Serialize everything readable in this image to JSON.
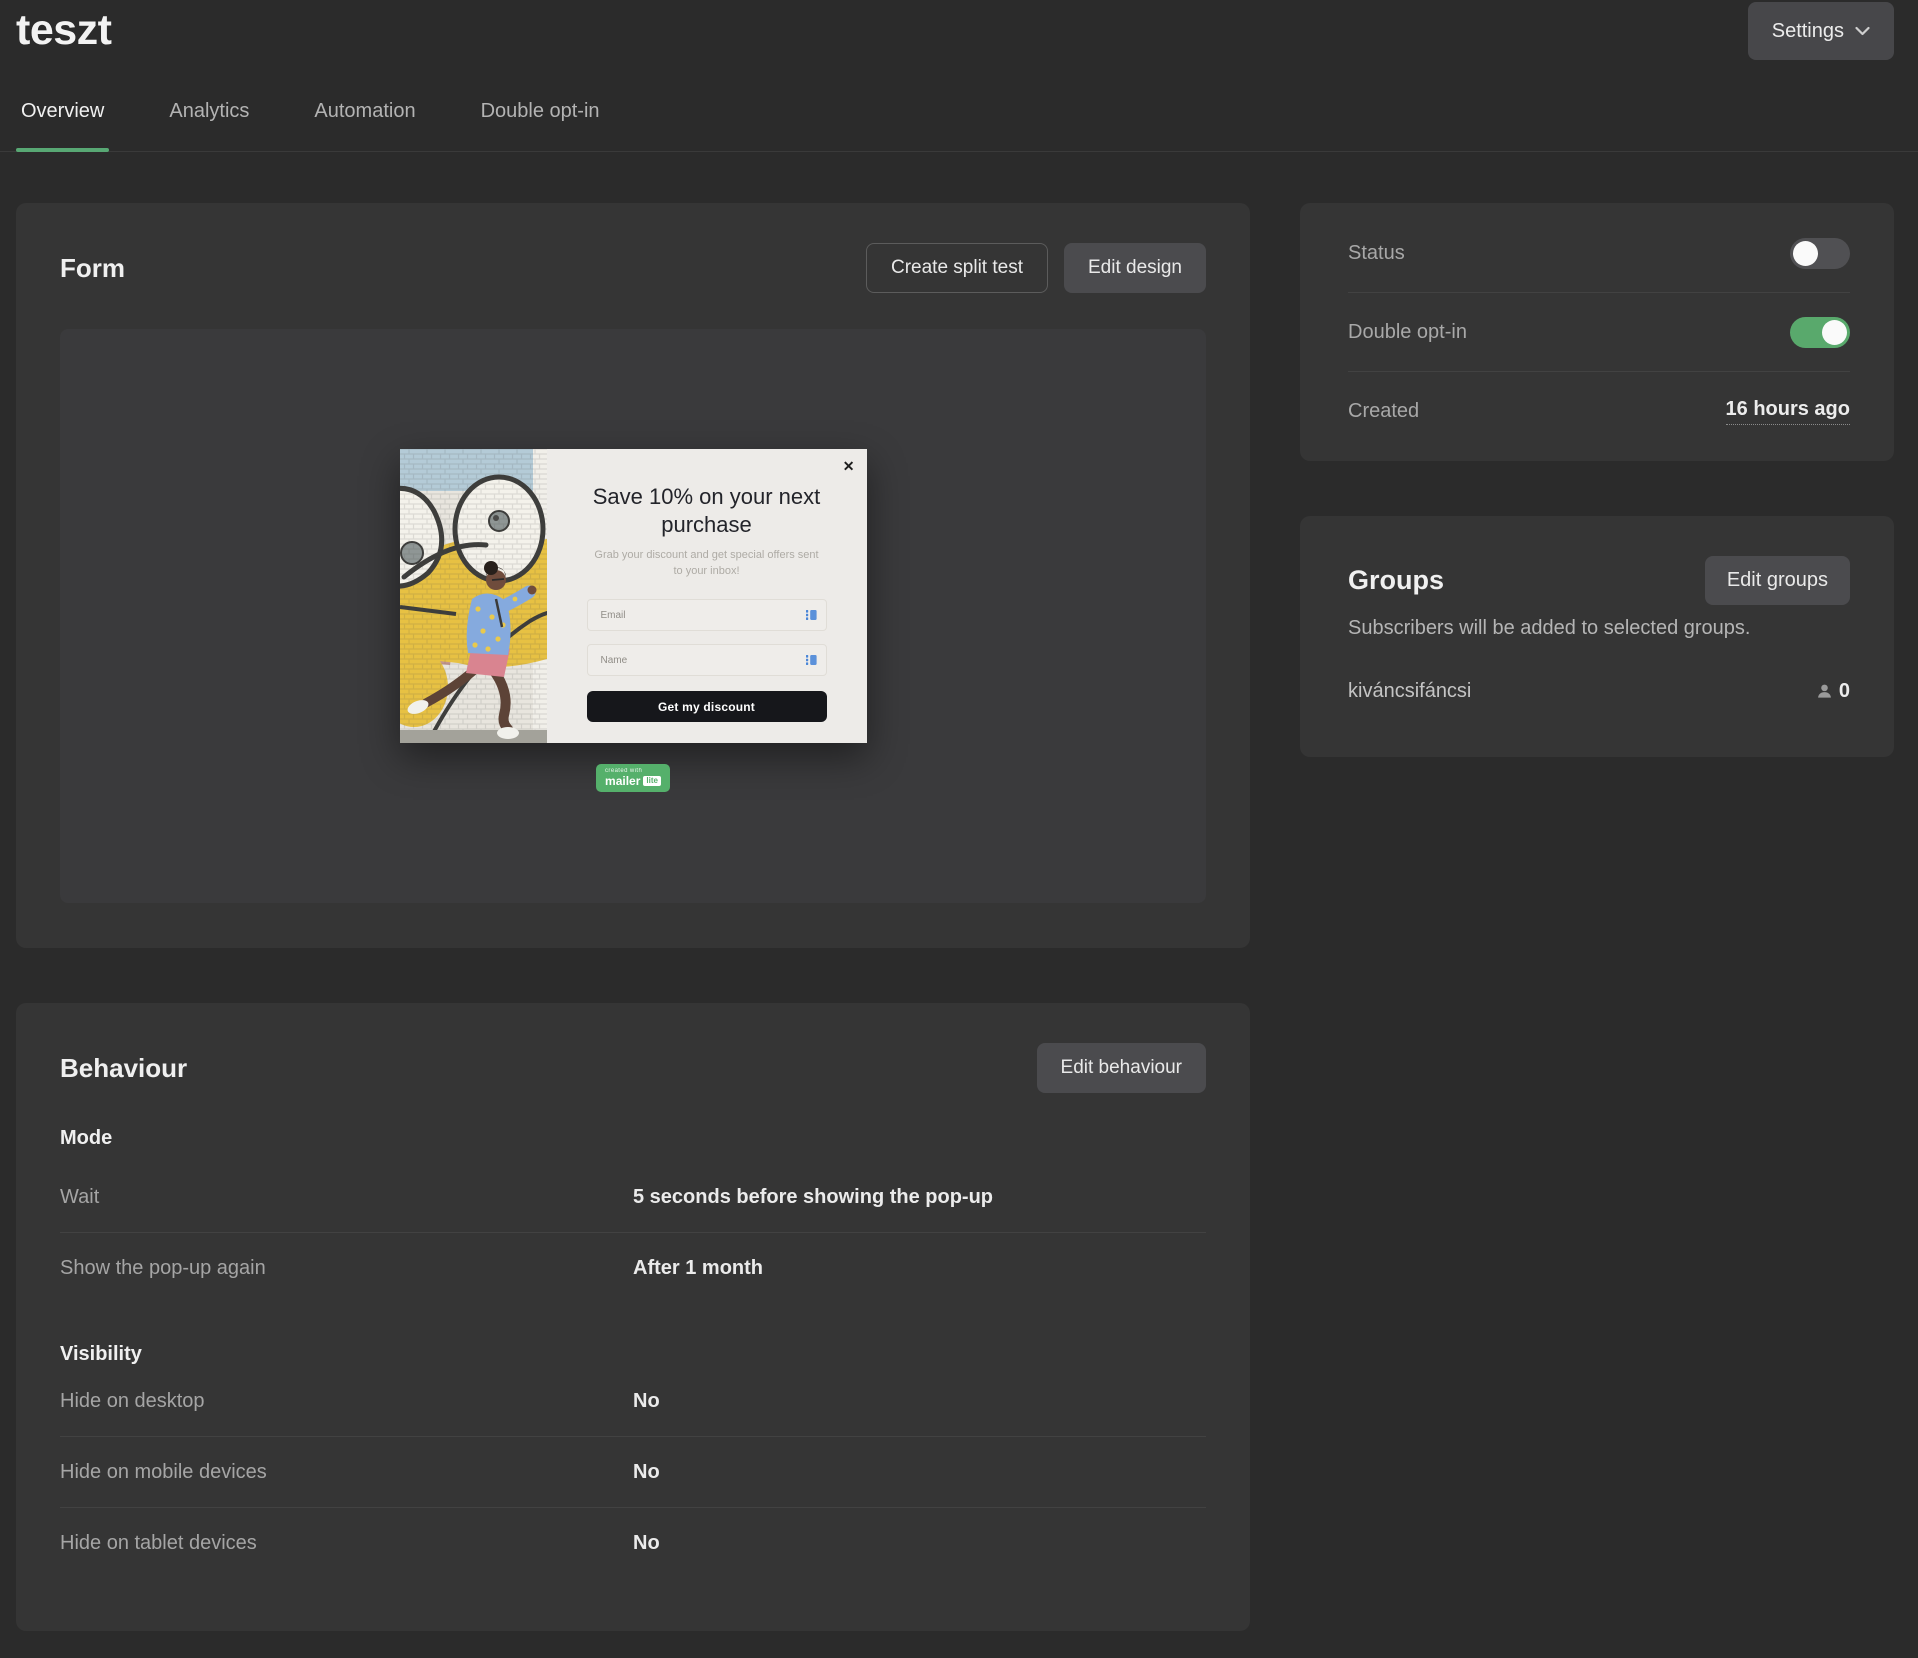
{
  "header": {
    "title": "teszt",
    "settings_label": "Settings"
  },
  "tabs": [
    {
      "label": "Overview",
      "active": true
    },
    {
      "label": "Analytics",
      "active": false
    },
    {
      "label": "Automation",
      "active": false
    },
    {
      "label": "Double opt-in",
      "active": false
    }
  ],
  "form_card": {
    "title": "Form",
    "buttons": {
      "create_split_test": "Create split test",
      "edit_design": "Edit design"
    },
    "popup": {
      "heading": "Save 10% on your next purchase",
      "subheading": "Grab your discount and get special offers sent to your inbox!",
      "email_placeholder": "Email",
      "name_placeholder": "Name",
      "submit_label": "Get my discount"
    },
    "badge": {
      "line1": "created with",
      "brand": "mailer",
      "suffix": "lite"
    }
  },
  "status_card": {
    "rows": [
      {
        "label": "Status",
        "toggle_state": "off"
      },
      {
        "label": "Double opt-in",
        "toggle_state": "on"
      },
      {
        "label": "Created",
        "value": "16 hours ago"
      }
    ]
  },
  "groups_card": {
    "title": "Groups",
    "edit_button": "Edit groups",
    "description": "Subscribers will be added to selected groups.",
    "groups": [
      {
        "name": "kiváncsifáncsi",
        "count": "0"
      }
    ]
  },
  "behaviour_card": {
    "title": "Behaviour",
    "edit_button": "Edit behaviour",
    "sections": [
      {
        "heading": "Mode",
        "rows": [
          {
            "label": "Wait",
            "value": "5 seconds before showing the pop-up"
          },
          {
            "label": "Show the pop-up again",
            "value": "After 1 month"
          }
        ]
      },
      {
        "heading": "Visibility",
        "rows": [
          {
            "label": "Hide on desktop",
            "value": "No"
          },
          {
            "label": "Hide on mobile devices",
            "value": "No"
          },
          {
            "label": "Hide on tablet devices",
            "value": "No"
          }
        ]
      }
    ]
  },
  "icons": {
    "popup_close": "✕",
    "settings_chevron": "chevron-down",
    "group_member": "person",
    "input_field": "personalization-tag"
  },
  "colors": {
    "accent_green": "#58a874",
    "toggle_green": "#59a96c",
    "badge_green": "#55b06b",
    "page_background": "#2b2b2b",
    "card_background": "#353535"
  }
}
